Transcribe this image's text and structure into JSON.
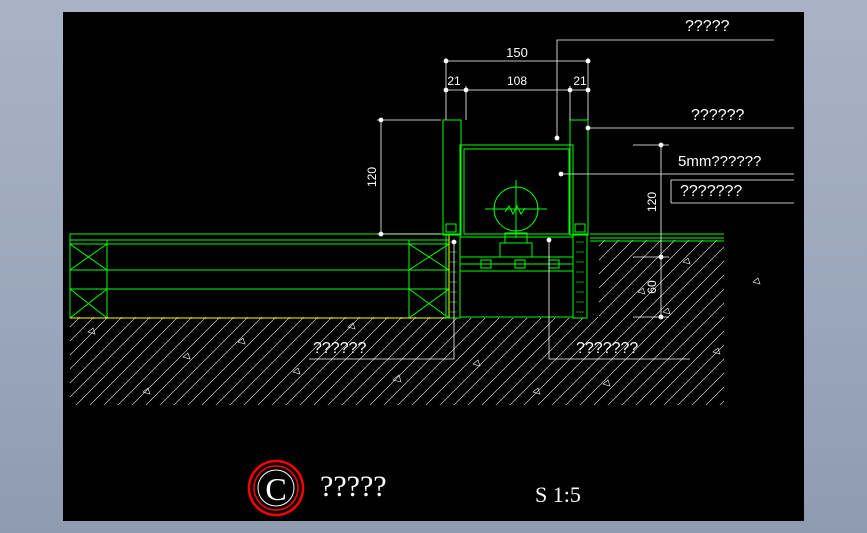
{
  "colors": {
    "background": "#9aa6bb",
    "canvas": "#000000",
    "outline": "#00ff00",
    "leader": "#ffffff",
    "stamp": "#ff0000"
  },
  "dimensions": {
    "total_width": "150",
    "left_gap": "21",
    "inner_width": "108",
    "right_gap": "21",
    "left_height": "120",
    "right_height": "120",
    "base_height": "60"
  },
  "callouts": {
    "top": "?????",
    "frame": "??????",
    "glass": "5mm??????",
    "lamp": "???????",
    "left_base": "??????",
    "right_base": "???????"
  },
  "title_block": {
    "marker": "C",
    "title": "?????",
    "scale": "S 1:5"
  }
}
